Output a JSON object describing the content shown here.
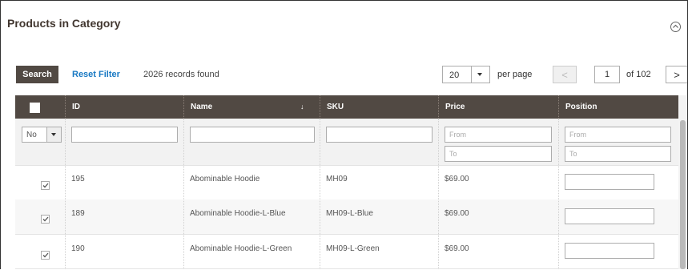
{
  "panel": {
    "title": "Products in Category"
  },
  "toolbar": {
    "search_label": "Search",
    "reset_label": "Reset Filter",
    "records_found": "2026 records found",
    "per_page_value": "20",
    "per_page_label": "per page",
    "current_page": "1",
    "of_pages": "of 102",
    "prev_label": "<",
    "next_label": ">"
  },
  "table": {
    "columns": [
      "",
      "ID",
      "Name",
      "SKU",
      "Price",
      "Position"
    ],
    "sort_indicator": "↓",
    "filters": {
      "in_category_value": "No",
      "price_from_placeholder": "From",
      "price_to_placeholder": "To",
      "position_from_placeholder": "From",
      "position_to_placeholder": "To"
    },
    "rows": [
      {
        "checked": true,
        "id": "195",
        "name": "Abominable Hoodie",
        "sku": "MH09",
        "price": "$69.00"
      },
      {
        "checked": true,
        "id": "189",
        "name": "Abominable Hoodie-L-Blue",
        "sku": "MH09-L-Blue",
        "price": "$69.00"
      },
      {
        "checked": true,
        "id": "190",
        "name": "Abominable Hoodie-L-Green",
        "sku": "MH09-L-Green",
        "price": "$69.00"
      }
    ]
  }
}
